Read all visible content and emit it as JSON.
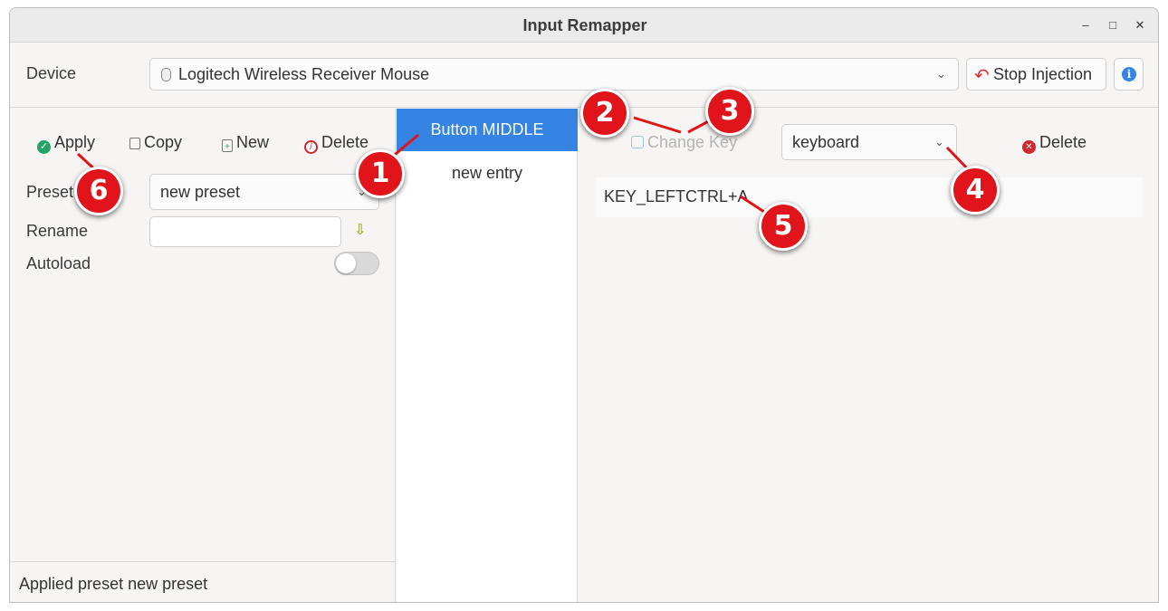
{
  "window": {
    "title": "Input Remapper",
    "minimize": "–",
    "maximize": "□",
    "close": "✕"
  },
  "device": {
    "label": "Device",
    "selected": "Logitech Wireless Receiver Mouse",
    "stop_injection": "Stop Injection",
    "info_icon": "info-icon"
  },
  "preset_toolbar": {
    "apply": "Apply",
    "copy": "Copy",
    "new": "New",
    "delete": "Delete"
  },
  "preset": {
    "preset_label": "Preset",
    "preset_value": "new preset",
    "rename_label": "Rename",
    "rename_value": "",
    "autoload_label": "Autoload",
    "autoload_on": false
  },
  "status": {
    "text": "Applied preset new preset"
  },
  "mappings": [
    {
      "label": "Button MIDDLE",
      "selected": true
    },
    {
      "label": "new entry",
      "selected": false
    }
  ],
  "editor": {
    "change_key": "Change Key",
    "target_type": "keyboard",
    "delete": "Delete",
    "output": "KEY_LEFTCTRL+A"
  },
  "callouts": [
    "1",
    "2",
    "3",
    "4",
    "5",
    "6"
  ],
  "colors": {
    "accent": "#3584e4",
    "callout": "#e0141a",
    "apply_green": "#26a269",
    "delete_red": "#d0272d"
  }
}
